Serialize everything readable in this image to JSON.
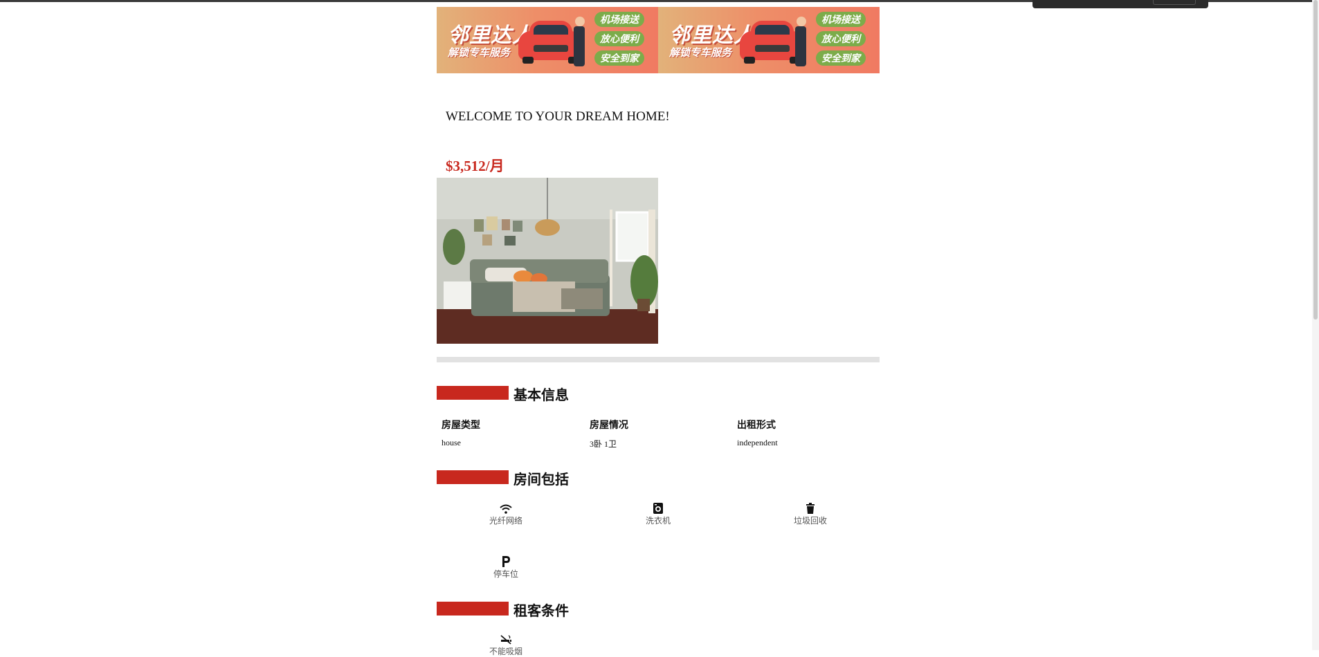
{
  "banners": [
    {
      "headline": "邻里达人",
      "subline": "解锁专车服务",
      "pills": [
        "机场接送",
        "放心便利",
        "安全到家"
      ]
    },
    {
      "headline": "邻里达人",
      "subline": "解锁专车服务",
      "pills": [
        "机场接送",
        "放心便利",
        "安全到家"
      ]
    }
  ],
  "listing": {
    "title": "WELCOME TO YOUR DREAM HOME!",
    "price": "$3,512/月"
  },
  "basic_info": {
    "heading": "基本信息",
    "fields": [
      {
        "label": "房屋类型",
        "value": "house"
      },
      {
        "label": "房屋情况",
        "value": "3卧 1卫"
      },
      {
        "label": "出租形式",
        "value": "independent"
      }
    ]
  },
  "amenities": {
    "heading": "房间包括",
    "items": [
      {
        "icon": "wifi-icon",
        "label": "光纤网络"
      },
      {
        "icon": "washing-machine-icon",
        "label": "洗衣机"
      },
      {
        "icon": "trash-icon",
        "label": "垃圾回收"
      },
      {
        "icon": "parking-icon",
        "label": "停车位"
      }
    ]
  },
  "tenant_conditions": {
    "heading": "租客条件",
    "items": [
      {
        "icon": "no-smoking-icon",
        "label": "不能吸烟"
      }
    ]
  },
  "colors": {
    "accent": "#c8281e",
    "divider": "#e2e2e2",
    "pill_green": "#7cac4a"
  }
}
